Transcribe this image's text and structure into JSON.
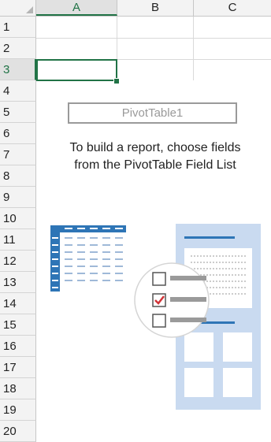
{
  "columns": [
    "A",
    "B",
    "C"
  ],
  "rows": [
    "1",
    "2",
    "3",
    "4",
    "5",
    "6",
    "7",
    "8",
    "9",
    "10",
    "11",
    "12",
    "13",
    "14",
    "15",
    "16",
    "17",
    "18",
    "19",
    "20"
  ],
  "selected_row": "3",
  "selected_column": "A",
  "pivot": {
    "name": "PivotTable1",
    "instruction_line1": "To build a report, choose fields",
    "instruction_line2": "from the PivotTable Field List"
  },
  "colors": {
    "accent": "#217346",
    "illustration_blue": "#2e75b6",
    "illustration_light": "#c9daf0",
    "check_red": "#d13438"
  },
  "icons": [
    "pivot-table-illustration-icon",
    "checklist-icon",
    "field-list-panel-icon"
  ]
}
